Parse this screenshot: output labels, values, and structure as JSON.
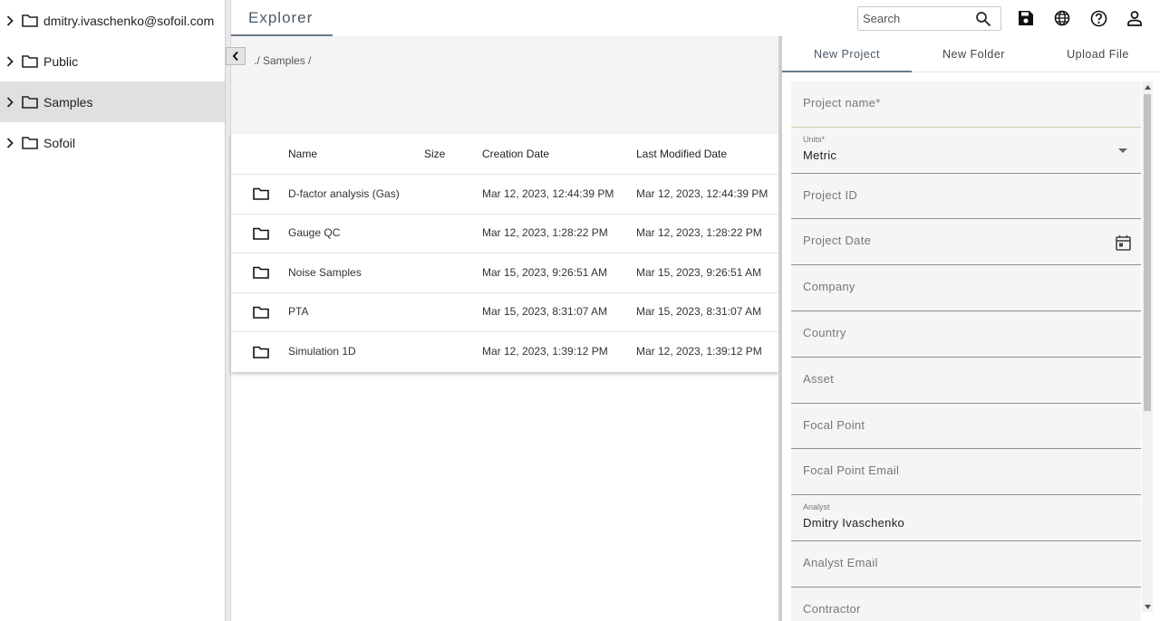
{
  "sidebar": {
    "items": [
      {
        "label": "dmitry.ivaschenko@sofoil.com",
        "selected": false
      },
      {
        "label": "Public",
        "selected": false
      },
      {
        "label": "Samples",
        "selected": true
      },
      {
        "label": "Sofoil",
        "selected": false
      }
    ]
  },
  "header": {
    "title": "Explorer",
    "search_placeholder": "Search",
    "icons": [
      "save-icon",
      "globe-icon",
      "help-icon",
      "account-icon"
    ]
  },
  "main": {
    "breadcrumb": "./ Samples /",
    "table": {
      "columns": [
        "Name",
        "Size",
        "Creation Date",
        "Last Modified Date"
      ],
      "rows": [
        {
          "name": "D-factor analysis (Gas)",
          "size": "",
          "created": "Mar 12, 2023, 12:44:39 PM",
          "modified": "Mar 12, 2023, 12:44:39 PM"
        },
        {
          "name": "Gauge QC",
          "size": "",
          "created": "Mar 12, 2023, 1:28:22 PM",
          "modified": "Mar 12, 2023, 1:28:22 PM"
        },
        {
          "name": "Noise Samples",
          "size": "",
          "created": "Mar 15, 2023, 9:26:51 AM",
          "modified": "Mar 15, 2023, 9:26:51 AM"
        },
        {
          "name": "PTA",
          "size": "",
          "created": "Mar 15, 2023, 8:31:07 AM",
          "modified": "Mar 15, 2023, 8:31:07 AM"
        },
        {
          "name": "Simulation 1D",
          "size": "",
          "created": "Mar 12, 2023, 1:39:12 PM",
          "modified": "Mar 12, 2023, 1:39:12 PM"
        }
      ]
    }
  },
  "right_panel": {
    "tabs": [
      {
        "label": "New Project",
        "active": true
      },
      {
        "label": "New Folder",
        "active": false
      },
      {
        "label": "Upload File",
        "active": false
      }
    ],
    "form": {
      "project_name": {
        "placeholder": "Project name*"
      },
      "units": {
        "label": "Units*",
        "value": "Metric"
      },
      "project_id": {
        "placeholder": "Project ID"
      },
      "project_date": {
        "placeholder": "Project Date"
      },
      "company": {
        "placeholder": "Company"
      },
      "country": {
        "placeholder": "Country"
      },
      "asset": {
        "placeholder": "Asset"
      },
      "focal_point": {
        "placeholder": "Focal Point"
      },
      "focal_point_email": {
        "placeholder": "Focal Point Email"
      },
      "analyst": {
        "label": "Analyst",
        "value": "Dmitry Ivaschenko"
      },
      "analyst_email": {
        "placeholder": "Analyst Email"
      },
      "contractor": {
        "placeholder": "Contractor"
      }
    }
  },
  "colors": {
    "accent": "#4a5a68",
    "selected_row": "#e0e0e0",
    "field_bg": "#f5f5f5"
  }
}
